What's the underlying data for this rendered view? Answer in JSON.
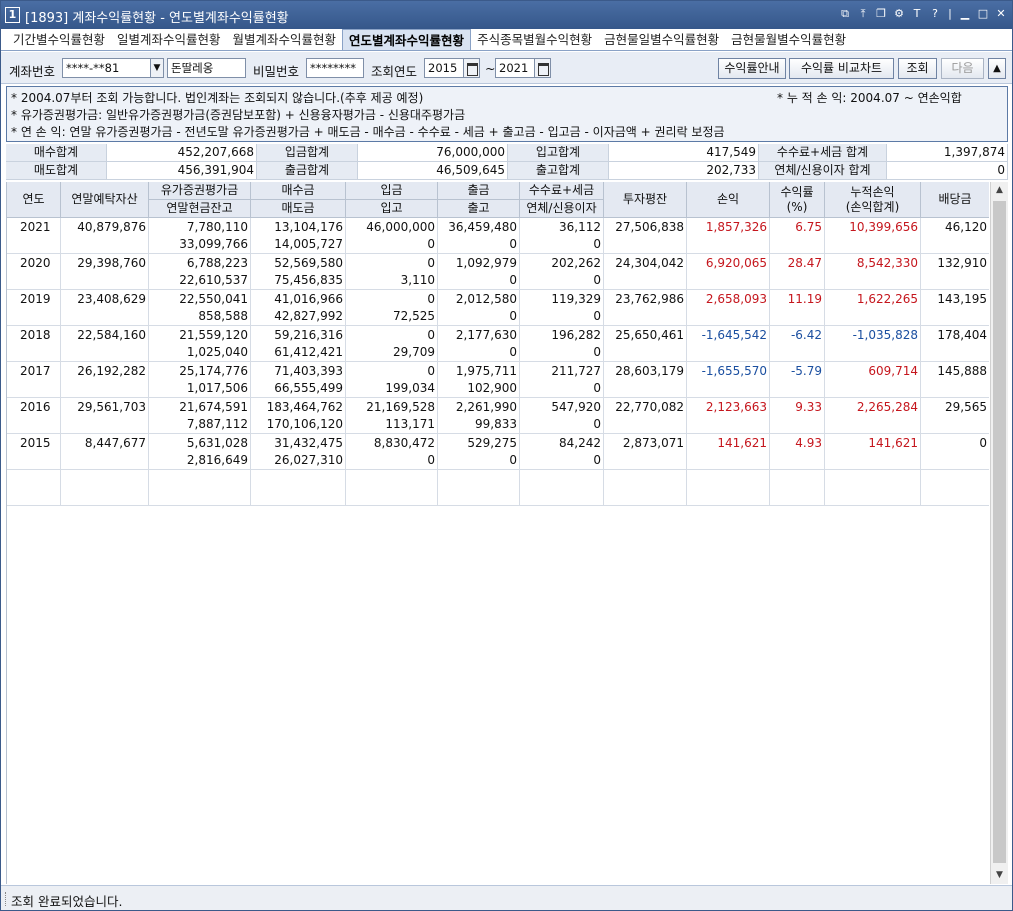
{
  "window": {
    "number": "1",
    "title": "[1893] 계좌수익률현황 - 연도별계좌수익률현황"
  },
  "tabs": [
    {
      "label": "기간별수익률현황"
    },
    {
      "label": "일별계좌수익률현황"
    },
    {
      "label": "월별계좌수익률현황"
    },
    {
      "label": "연도별계좌수익률현황"
    },
    {
      "label": "주식종목별월수익현황"
    },
    {
      "label": "금현물일별수익률현황"
    },
    {
      "label": "금현물월별수익률현황"
    }
  ],
  "toolbar": {
    "account_label": "계좌번호",
    "account_value": "****-**81",
    "account_name": "돈딸레옹",
    "password_label": "비밀번호",
    "password_value": "********",
    "year_label": "조회연도",
    "year_from": "2015",
    "year_sep": "~",
    "year_to": "2021",
    "btn_guide": "수익률안내",
    "btn_compare": "수익률 비교차트",
    "btn_search": "조회",
    "btn_next": "다음",
    "btn_up": "▲"
  },
  "info": {
    "line1": "* 2004.07부터 조회 가능합니다. 법인계좌는 조회되지 않습니다.(추후 제공 예정)",
    "line2": "* 유가증권평가금: 일반유가증권평가금(증권담보포함) + 신용융자평가금 - 신용대주평가금",
    "line3": "* 연 손 익: 연말 유가증권평가금 - 전년도말 유가증권평가금 + 매도금 - 매수금 - 수수료 - 세금 + 출고금 - 입고금 - 이자금액 + 권리락 보정금",
    "right": "* 누 적 손 익: 2004.07 ~ 연손익합"
  },
  "summary": {
    "buy_total_label": "매수합계",
    "buy_total": "452,207,668",
    "deposit_total_label": "입금합계",
    "deposit_total": "76,000,000",
    "in_total_label": "입고합계",
    "in_total": "417,549",
    "fee_tax_label": "수수료+세금 합계",
    "fee_tax": "1,397,874",
    "sell_total_label": "매도합계",
    "sell_total": "456,391,904",
    "withdraw_total_label": "출금합계",
    "withdraw_total": "46,509,645",
    "out_total_label": "출고합계",
    "out_total": "202,733",
    "overdue_label": "연체/신용이자 합계",
    "overdue": "0"
  },
  "table": {
    "headers": {
      "year": "연도",
      "year_end_assets": "연말예탁자산",
      "securities_eval": "유가증권평가금",
      "cash_balance": "연말현금잔고",
      "buy": "매수금",
      "sell": "매도금",
      "deposit": "입금",
      "in": "입고",
      "withdraw": "출금",
      "out": "출고",
      "fee_tax": "수수료+세금",
      "overdue_interest": "연체/신용이자",
      "avg_invest": "투자평잔",
      "pnl": "손익",
      "return_rate": "수익률",
      "return_unit": "(%)",
      "cum_pnl": "누적손익",
      "cum_pnl_sub": "(손익합계)",
      "dividend": "배당금"
    },
    "rows": [
      {
        "year": "2021",
        "assets": "40,879,876",
        "sec": "7,780,110",
        "cash": "33,099,766",
        "buy": "13,104,176",
        "sell": "14,005,727",
        "dep": "46,000,000",
        "in": "0",
        "wd": "36,459,480",
        "out": "0",
        "fee": "36,112",
        "ovd": "0",
        "avg": "27,506,838",
        "pnl": "1,857,326",
        "rate": "6.75",
        "cum": "10,399,656",
        "div": "46,120",
        "sign": "pos"
      },
      {
        "year": "2020",
        "assets": "29,398,760",
        "sec": "6,788,223",
        "cash": "22,610,537",
        "buy": "52,569,580",
        "sell": "75,456,835",
        "dep": "0",
        "in": "3,110",
        "wd": "1,092,979",
        "out": "0",
        "fee": "202,262",
        "ovd": "0",
        "avg": "24,304,042",
        "pnl": "6,920,065",
        "rate": "28.47",
        "cum": "8,542,330",
        "div": "132,910",
        "sign": "pos"
      },
      {
        "year": "2019",
        "assets": "23,408,629",
        "sec": "22,550,041",
        "cash": "858,588",
        "buy": "41,016,966",
        "sell": "42,827,992",
        "dep": "0",
        "in": "72,525",
        "wd": "2,012,580",
        "out": "0",
        "fee": "119,329",
        "ovd": "0",
        "avg": "23,762,986",
        "pnl": "2,658,093",
        "rate": "11.19",
        "cum": "1,622,265",
        "div": "143,195",
        "sign": "pos"
      },
      {
        "year": "2018",
        "assets": "22,584,160",
        "sec": "21,559,120",
        "cash": "1,025,040",
        "buy": "59,216,316",
        "sell": "61,412,421",
        "dep": "0",
        "in": "29,709",
        "wd": "2,177,630",
        "out": "0",
        "fee": "196,282",
        "ovd": "0",
        "avg": "25,650,461",
        "pnl": "-1,645,542",
        "rate": "-6.42",
        "cum": "-1,035,828",
        "div": "178,404",
        "sign": "neg"
      },
      {
        "year": "2017",
        "assets": "26,192,282",
        "sec": "25,174,776",
        "cash": "1,017,506",
        "buy": "71,403,393",
        "sell": "66,555,499",
        "dep": "0",
        "in": "199,034",
        "wd": "1,975,711",
        "out": "102,900",
        "fee": "211,727",
        "ovd": "0",
        "avg": "28,603,179",
        "pnl": "-1,655,570",
        "rate": "-5.79",
        "cum": "609,714",
        "div": "145,888",
        "sign": "neg"
      },
      {
        "year": "2016",
        "assets": "29,561,703",
        "sec": "21,674,591",
        "cash": "7,887,112",
        "buy": "183,464,762",
        "sell": "170,106,120",
        "dep": "21,169,528",
        "in": "113,171",
        "wd": "2,261,990",
        "out": "99,833",
        "fee": "547,920",
        "ovd": "0",
        "avg": "22,770,082",
        "pnl": "2,123,663",
        "rate": "9.33",
        "cum": "2,265,284",
        "div": "29,565",
        "sign": "pos"
      },
      {
        "year": "2015",
        "assets": "8,447,677",
        "sec": "5,631,028",
        "cash": "2,816,649",
        "buy": "31,432,475",
        "sell": "26,027,310",
        "dep": "8,830,472",
        "in": "0",
        "wd": "529,275",
        "out": "0",
        "fee": "84,242",
        "ovd": "0",
        "avg": "2,873,071",
        "pnl": "141,621",
        "rate": "4.93",
        "cum": "141,621",
        "div": "0",
        "sign": "pos"
      }
    ]
  },
  "status": {
    "message": "조회 완료되었습니다."
  },
  "colors": {
    "positive": "#c5161d",
    "negative": "#1b4fa0",
    "titlebar": "#3f6298"
  }
}
